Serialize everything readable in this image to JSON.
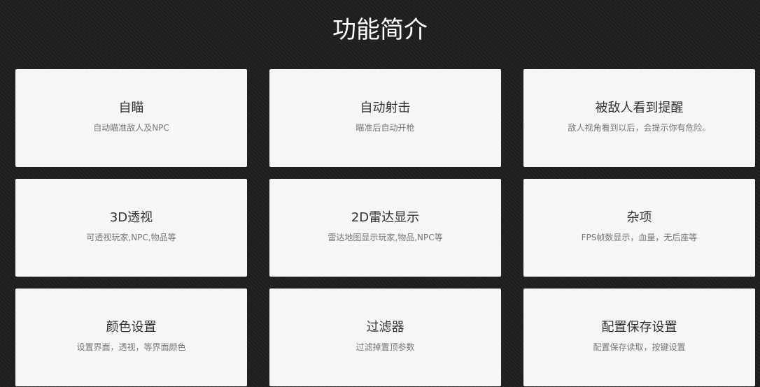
{
  "section": {
    "title": "功能简介"
  },
  "features": [
    {
      "title": "自瞄",
      "desc": "自动瞄准敌人及NPC"
    },
    {
      "title": "自动射击",
      "desc": "瞄准后自动开枪"
    },
    {
      "title": "被敌人看到提醒",
      "desc": "敌人视角看到以后，会提示你有危险。"
    },
    {
      "title": "3D透视",
      "desc": "可透视玩家,NPC,物品等"
    },
    {
      "title": "2D雷达显示",
      "desc": "雷达地图显示玩家,物品,NPC等"
    },
    {
      "title": "杂项",
      "desc": "FPS帧数显示，血量，无后座等"
    },
    {
      "title": "颜色设置",
      "desc": "设置界面，透视，等界面颜色"
    },
    {
      "title": "过滤器",
      "desc": "过滤掉置顶参数"
    },
    {
      "title": "配置保存设置",
      "desc": "配置保存读取，按键设置"
    }
  ],
  "colors": {
    "background": "#1e1e1e",
    "card": "#f6f6f6",
    "title_text": "#ffffff",
    "card_title": "#333333",
    "card_desc": "#777777"
  }
}
